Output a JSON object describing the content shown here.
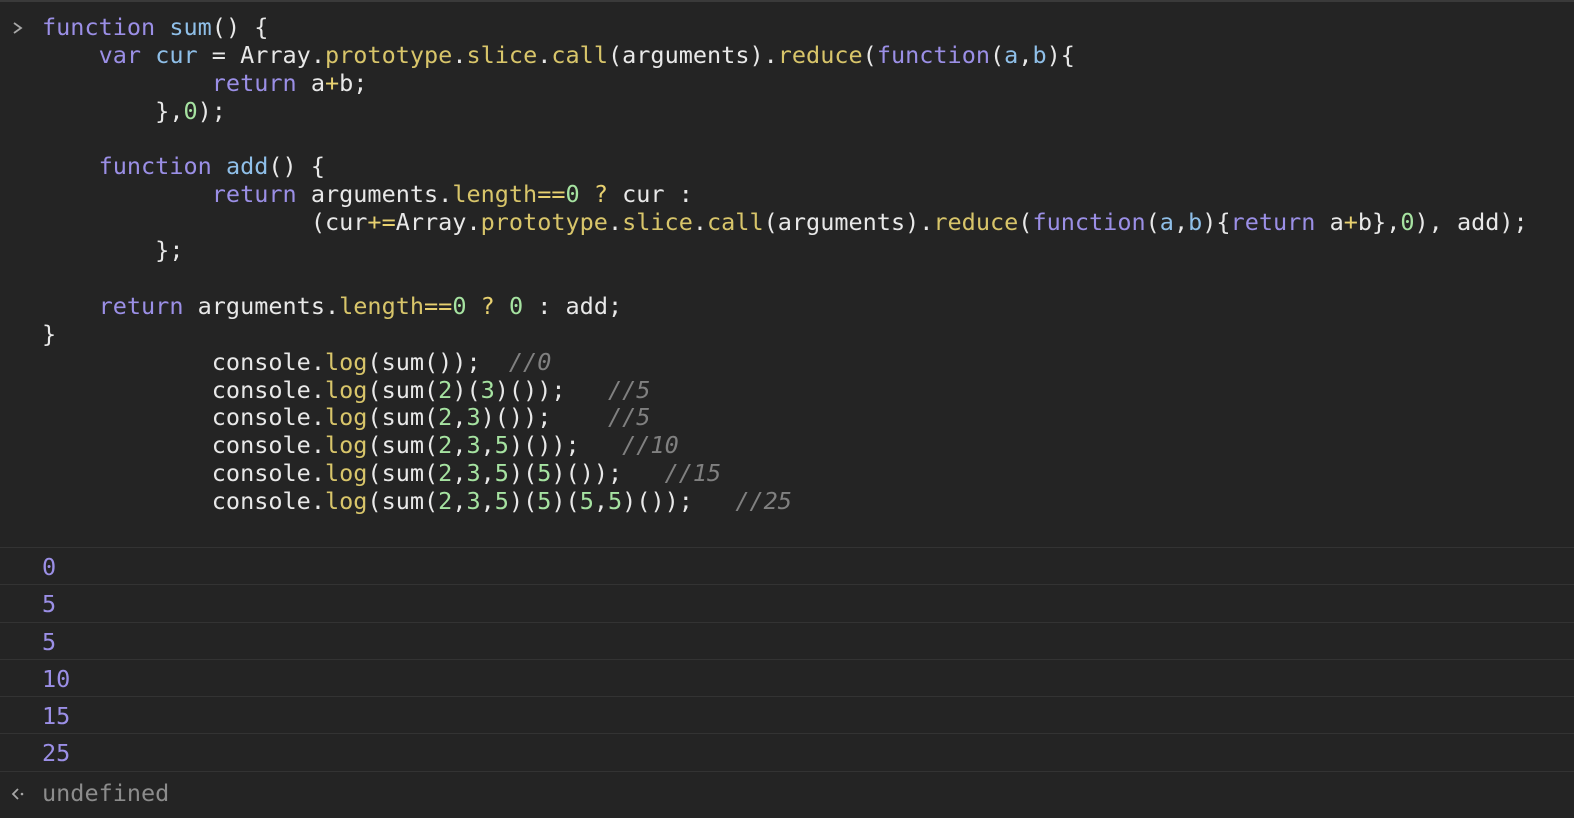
{
  "console": {
    "prompt_icon": "chevron-right-icon",
    "code_lines": [
      [
        {
          "t": "kw",
          "v": "function "
        },
        {
          "t": "fn",
          "v": "sum"
        },
        {
          "t": "plain",
          "v": "() {"
        }
      ],
      [
        {
          "t": "plain",
          "v": "    "
        },
        {
          "t": "kw",
          "v": "var "
        },
        {
          "t": "fn",
          "v": "cur"
        },
        {
          "t": "plain",
          "v": " = Array."
        },
        {
          "t": "prop",
          "v": "prototype"
        },
        {
          "t": "plain",
          "v": "."
        },
        {
          "t": "prop",
          "v": "slice"
        },
        {
          "t": "plain",
          "v": "."
        },
        {
          "t": "prop",
          "v": "call"
        },
        {
          "t": "plain",
          "v": "(arguments)."
        },
        {
          "t": "prop",
          "v": "reduce"
        },
        {
          "t": "plain",
          "v": "("
        },
        {
          "t": "kw",
          "v": "function"
        },
        {
          "t": "plain",
          "v": "("
        },
        {
          "t": "fn",
          "v": "a"
        },
        {
          "t": "plain",
          "v": ","
        },
        {
          "t": "fn",
          "v": "b"
        },
        {
          "t": "plain",
          "v": "){"
        }
      ],
      [
        {
          "t": "plain",
          "v": "            "
        },
        {
          "t": "kw",
          "v": "return "
        },
        {
          "t": "plain",
          "v": "a"
        },
        {
          "t": "op",
          "v": "+"
        },
        {
          "t": "plain",
          "v": "b;"
        }
      ],
      [
        {
          "t": "plain",
          "v": "        },"
        },
        {
          "t": "num",
          "v": "0"
        },
        {
          "t": "plain",
          "v": ");"
        }
      ],
      [
        {
          "t": "plain",
          "v": ""
        }
      ],
      [
        {
          "t": "plain",
          "v": "    "
        },
        {
          "t": "kw",
          "v": "function "
        },
        {
          "t": "fn",
          "v": "add"
        },
        {
          "t": "plain",
          "v": "() {"
        }
      ],
      [
        {
          "t": "plain",
          "v": "            "
        },
        {
          "t": "kw",
          "v": "return "
        },
        {
          "t": "plain",
          "v": "arguments."
        },
        {
          "t": "prop",
          "v": "length"
        },
        {
          "t": "op",
          "v": "=="
        },
        {
          "t": "num",
          "v": "0"
        },
        {
          "t": "plain",
          "v": " "
        },
        {
          "t": "op",
          "v": "?"
        },
        {
          "t": "plain",
          "v": " cur :"
        }
      ],
      [
        {
          "t": "plain",
          "v": "                   (cur"
        },
        {
          "t": "op",
          "v": "+="
        },
        {
          "t": "plain",
          "v": "Array."
        },
        {
          "t": "prop",
          "v": "prototype"
        },
        {
          "t": "plain",
          "v": "."
        },
        {
          "t": "prop",
          "v": "slice"
        },
        {
          "t": "plain",
          "v": "."
        },
        {
          "t": "prop",
          "v": "call"
        },
        {
          "t": "plain",
          "v": "(arguments)."
        },
        {
          "t": "prop",
          "v": "reduce"
        },
        {
          "t": "plain",
          "v": "("
        },
        {
          "t": "kw",
          "v": "function"
        },
        {
          "t": "plain",
          "v": "("
        },
        {
          "t": "fn",
          "v": "a"
        },
        {
          "t": "plain",
          "v": ","
        },
        {
          "t": "fn",
          "v": "b"
        },
        {
          "t": "plain",
          "v": "){"
        },
        {
          "t": "kw",
          "v": "return "
        },
        {
          "t": "plain",
          "v": "a"
        },
        {
          "t": "op",
          "v": "+"
        },
        {
          "t": "plain",
          "v": "b},"
        },
        {
          "t": "num",
          "v": "0"
        },
        {
          "t": "plain",
          "v": "), add);"
        }
      ],
      [
        {
          "t": "plain",
          "v": "        };"
        }
      ],
      [
        {
          "t": "plain",
          "v": ""
        }
      ],
      [
        {
          "t": "plain",
          "v": "    "
        },
        {
          "t": "kw",
          "v": "return "
        },
        {
          "t": "plain",
          "v": "arguments."
        },
        {
          "t": "prop",
          "v": "length"
        },
        {
          "t": "op",
          "v": "=="
        },
        {
          "t": "num",
          "v": "0"
        },
        {
          "t": "plain",
          "v": " "
        },
        {
          "t": "op",
          "v": "?"
        },
        {
          "t": "plain",
          "v": " "
        },
        {
          "t": "num",
          "v": "0"
        },
        {
          "t": "plain",
          "v": " : add;"
        }
      ],
      [
        {
          "t": "plain",
          "v": "}"
        }
      ],
      [
        {
          "t": "plain",
          "v": "            console."
        },
        {
          "t": "prop",
          "v": "log"
        },
        {
          "t": "plain",
          "v": "(sum());  "
        },
        {
          "t": "cmt",
          "v": "//0"
        }
      ],
      [
        {
          "t": "plain",
          "v": "            console."
        },
        {
          "t": "prop",
          "v": "log"
        },
        {
          "t": "plain",
          "v": "(sum("
        },
        {
          "t": "num",
          "v": "2"
        },
        {
          "t": "plain",
          "v": ")("
        },
        {
          "t": "num",
          "v": "3"
        },
        {
          "t": "plain",
          "v": ")());   "
        },
        {
          "t": "cmt",
          "v": "//5"
        }
      ],
      [
        {
          "t": "plain",
          "v": "            console."
        },
        {
          "t": "prop",
          "v": "log"
        },
        {
          "t": "plain",
          "v": "(sum("
        },
        {
          "t": "num",
          "v": "2"
        },
        {
          "t": "plain",
          "v": ","
        },
        {
          "t": "num",
          "v": "3"
        },
        {
          "t": "plain",
          "v": ")());    "
        },
        {
          "t": "cmt",
          "v": "//5"
        }
      ],
      [
        {
          "t": "plain",
          "v": "            console."
        },
        {
          "t": "prop",
          "v": "log"
        },
        {
          "t": "plain",
          "v": "(sum("
        },
        {
          "t": "num",
          "v": "2"
        },
        {
          "t": "plain",
          "v": ","
        },
        {
          "t": "num",
          "v": "3"
        },
        {
          "t": "plain",
          "v": ","
        },
        {
          "t": "num",
          "v": "5"
        },
        {
          "t": "plain",
          "v": ")());   "
        },
        {
          "t": "cmt",
          "v": "//10"
        }
      ],
      [
        {
          "t": "plain",
          "v": "            console."
        },
        {
          "t": "prop",
          "v": "log"
        },
        {
          "t": "plain",
          "v": "(sum("
        },
        {
          "t": "num",
          "v": "2"
        },
        {
          "t": "plain",
          "v": ","
        },
        {
          "t": "num",
          "v": "3"
        },
        {
          "t": "plain",
          "v": ","
        },
        {
          "t": "num",
          "v": "5"
        },
        {
          "t": "plain",
          "v": ")("
        },
        {
          "t": "num",
          "v": "5"
        },
        {
          "t": "plain",
          "v": ")());   "
        },
        {
          "t": "cmt",
          "v": "//15"
        }
      ],
      [
        {
          "t": "plain",
          "v": "            console."
        },
        {
          "t": "prop",
          "v": "log"
        },
        {
          "t": "plain",
          "v": "(sum("
        },
        {
          "t": "num",
          "v": "2"
        },
        {
          "t": "plain",
          "v": ","
        },
        {
          "t": "num",
          "v": "3"
        },
        {
          "t": "plain",
          "v": ","
        },
        {
          "t": "num",
          "v": "5"
        },
        {
          "t": "plain",
          "v": ")("
        },
        {
          "t": "num",
          "v": "5"
        },
        {
          "t": "plain",
          "v": ")("
        },
        {
          "t": "num",
          "v": "5"
        },
        {
          "t": "plain",
          "v": ","
        },
        {
          "t": "num",
          "v": "5"
        },
        {
          "t": "plain",
          "v": ")());   "
        },
        {
          "t": "cmt",
          "v": "//25"
        }
      ]
    ],
    "outputs": [
      "0",
      "5",
      "5",
      "10",
      "15",
      "25"
    ],
    "return_icon": "return-arrow-icon",
    "return_value": "undefined"
  },
  "colors": {
    "background": "#242424",
    "keyword": "#9b8fe6",
    "function_name": "#8fbfe8",
    "property": "#d8c56a",
    "number": "#a6e3a1",
    "comment": "#808080",
    "output_number": "#9b8fe6"
  }
}
